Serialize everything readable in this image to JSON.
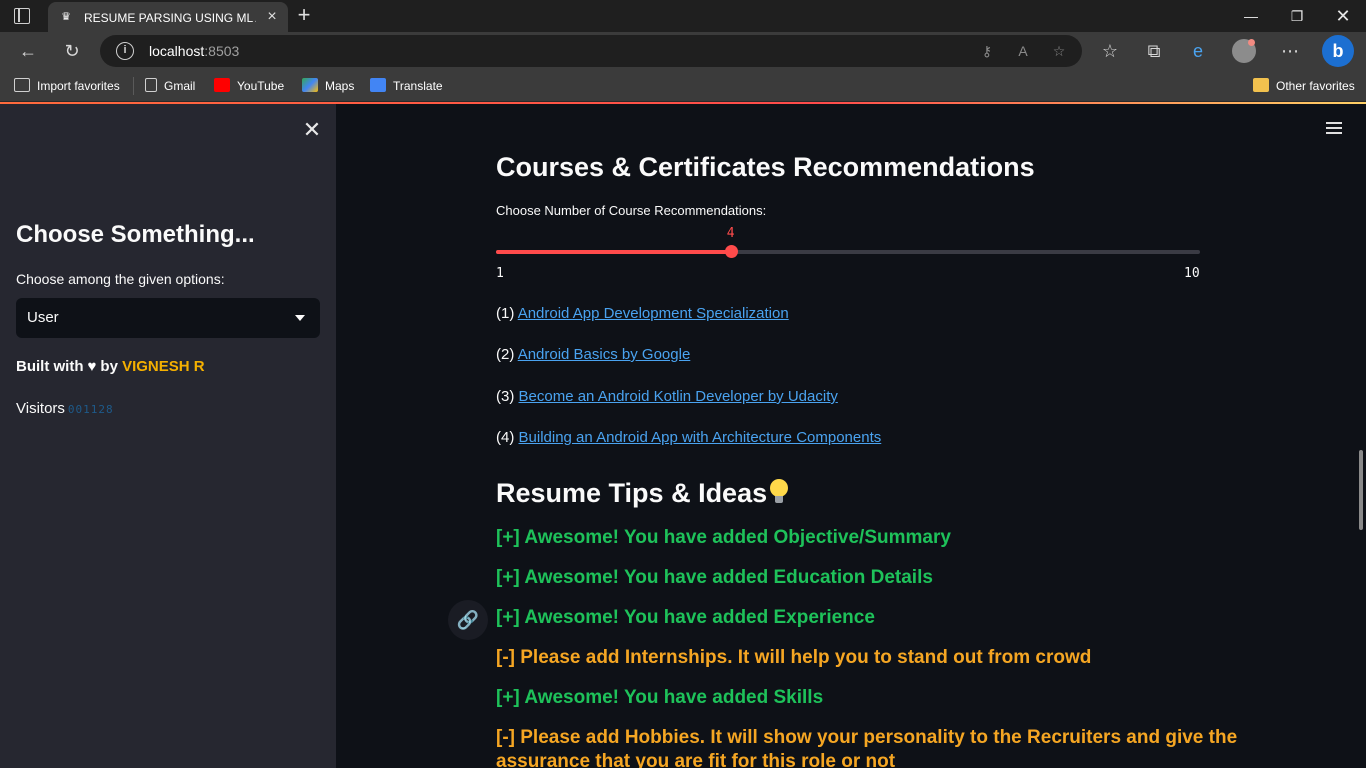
{
  "browser": {
    "tab_title": "RESUME PARSING USING ML AN",
    "url_host": "localhost",
    "url_port": ":8503",
    "favorites": [
      {
        "label": "Import favorites",
        "icon": "import-icon"
      },
      {
        "label": "Gmail",
        "icon": "page-icon"
      },
      {
        "label": "YouTube",
        "icon": "youtube-icon"
      },
      {
        "label": "Maps",
        "icon": "maps-icon"
      },
      {
        "label": "Translate",
        "icon": "translate-icon"
      }
    ],
    "other_favorites": "Other favorites"
  },
  "sidebar": {
    "title": "Choose Something...",
    "select_label": "Choose among the given options:",
    "select_value": "User",
    "built_prefix": "Built with",
    "built_by": "by",
    "author": "VIGNESH R",
    "visitors_label": "Visitors",
    "visitors_count": "001128"
  },
  "main": {
    "courses_title": "Courses & Certificates Recommendations",
    "slider": {
      "label": "Choose Number of Course Recommendations:",
      "value": 4,
      "min": 1,
      "max": 10
    },
    "courses": [
      {
        "num": "(1)",
        "title": "Android App Development Specialization"
      },
      {
        "num": "(2)",
        "title": "Android Basics by Google"
      },
      {
        "num": "(3)",
        "title": "Become an Android Kotlin Developer by Udacity"
      },
      {
        "num": "(4)",
        "title": "Building an Android App with Architecture Components"
      }
    ],
    "tips_title": "Resume Tips & Ideas",
    "tips": [
      {
        "text": "[+] Awesome! You have added Objective/Summary",
        "status": "ok"
      },
      {
        "text": "[+] Awesome! You have added Education Details",
        "status": "ok"
      },
      {
        "text": "[+] Awesome! You have added Experience",
        "status": "ok"
      },
      {
        "text": "[-] Please add Internships. It will help you to stand out from crowd",
        "status": "warn"
      },
      {
        "text": "[+] Awesome! You have added Skills",
        "status": "ok"
      },
      {
        "text": "[-] Please add Hobbies. It will show your personality to the Recruiters and give the",
        "status": "warn"
      },
      {
        "text": "assurance that you are fit for this role or not",
        "status": "warn"
      }
    ]
  },
  "colors": {
    "accent": "#ff4b4b",
    "link": "#4aa3f0",
    "ok": "#1ec25a",
    "warn": "#f5a623"
  }
}
